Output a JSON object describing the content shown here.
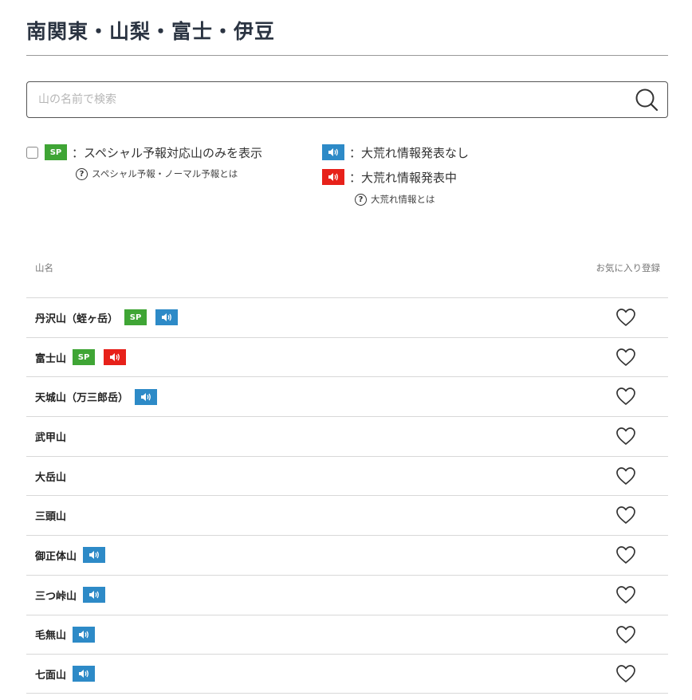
{
  "page": {
    "title": "南関東・山梨・富士・伊豆"
  },
  "search": {
    "placeholder": "山の名前で検索",
    "icon": "search-icon"
  },
  "legend": {
    "sp_badge": "SP",
    "sp_filter_label": "：スペシャル予報対応山のみを表示",
    "sp_filter_checked": false,
    "sp_help": "スペシャル予報・ノーマル予報とは",
    "storm_none_label": "：大荒れ情報発表なし",
    "storm_active_label": "：大荒れ情報発表中",
    "storm_help": "大荒れ情報とは"
  },
  "colors": {
    "sp_green": "#3fa535",
    "storm_none_blue": "#2d8ac7",
    "storm_active_red": "#e7211a"
  },
  "table": {
    "col_name": "山名",
    "col_favorite": "お気に入り登録"
  },
  "mountains": [
    {
      "name": "丹沢山（蛭ヶ岳）",
      "sp": true,
      "storm": "none"
    },
    {
      "name": "富士山",
      "sp": true,
      "storm": "active"
    },
    {
      "name": "天城山（万三郎岳）",
      "sp": false,
      "storm": "none"
    },
    {
      "name": "武甲山",
      "sp": false,
      "storm": ""
    },
    {
      "name": "大岳山",
      "sp": false,
      "storm": ""
    },
    {
      "name": "三頭山",
      "sp": false,
      "storm": ""
    },
    {
      "name": "御正体山",
      "sp": false,
      "storm": "none"
    },
    {
      "name": "三つ峠山",
      "sp": false,
      "storm": "none"
    },
    {
      "name": "毛無山",
      "sp": false,
      "storm": "none"
    },
    {
      "name": "七面山",
      "sp": false,
      "storm": "none"
    }
  ]
}
